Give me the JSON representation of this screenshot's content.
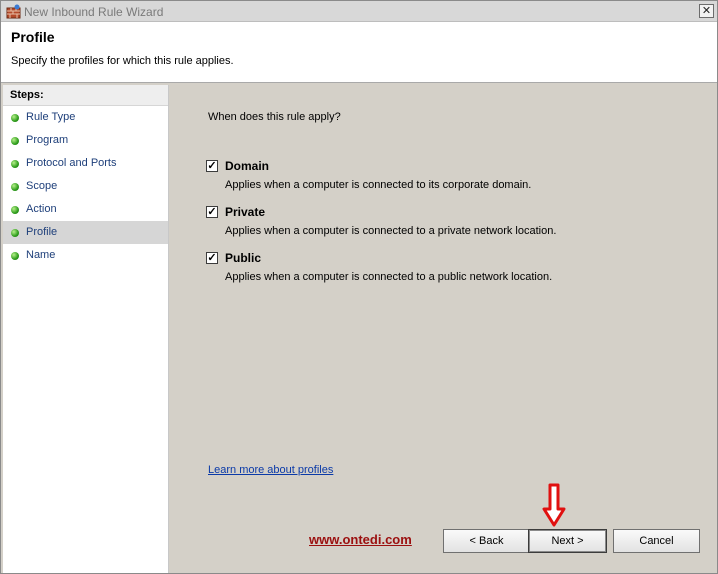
{
  "window": {
    "title": "New Inbound Rule Wizard",
    "close_glyph": "✕"
  },
  "header": {
    "title": "Profile",
    "subtitle": "Specify the profiles for which this rule applies."
  },
  "steps": {
    "heading": "Steps:",
    "items": [
      {
        "label": "Rule Type"
      },
      {
        "label": "Program"
      },
      {
        "label": "Protocol and Ports"
      },
      {
        "label": "Scope"
      },
      {
        "label": "Action"
      },
      {
        "label": "Profile",
        "active": true
      },
      {
        "label": "Name"
      }
    ]
  },
  "content": {
    "question": "When does this rule apply?",
    "options": [
      {
        "label": "Domain",
        "checked": true,
        "description": "Applies when a computer is connected to its corporate domain."
      },
      {
        "label": "Private",
        "checked": true,
        "description": "Applies when a computer is connected to a private network location."
      },
      {
        "label": "Public",
        "checked": true,
        "description": "Applies when a computer is connected to a public network location."
      }
    ],
    "check_glyph": "✓",
    "learn_more": "Learn more about profiles",
    "watermark": "www.ontedi.com"
  },
  "buttons": {
    "back": "< Back",
    "next": "Next >",
    "cancel": "Cancel"
  },
  "colors": {
    "link": "#0b3aa8",
    "watermark": "#9b0f0f",
    "arrow": "#e01010",
    "step_dot": "#2e9d1c"
  }
}
